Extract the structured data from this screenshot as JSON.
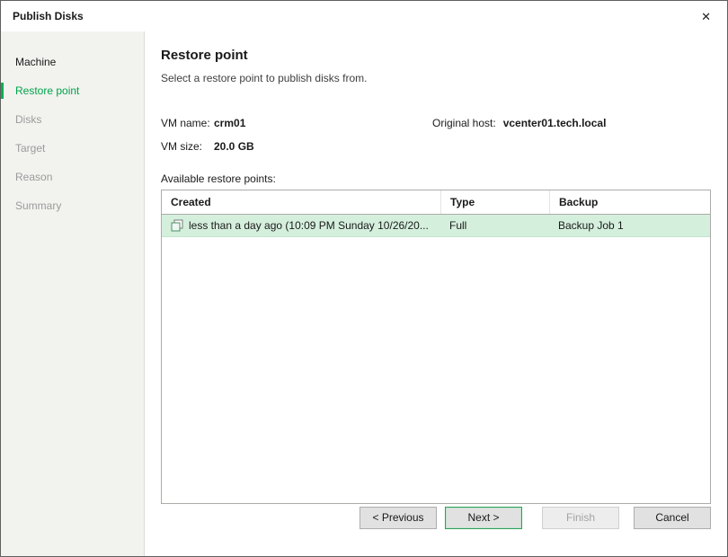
{
  "window": {
    "title": "Publish Disks",
    "close_glyph": "✕"
  },
  "sidebar": {
    "items": [
      {
        "label": "Machine",
        "state": "done"
      },
      {
        "label": "Restore point",
        "state": "active"
      },
      {
        "label": "Disks",
        "state": "pending"
      },
      {
        "label": "Target",
        "state": "pending"
      },
      {
        "label": "Reason",
        "state": "pending"
      },
      {
        "label": "Summary",
        "state": "pending"
      }
    ]
  },
  "main": {
    "title": "Restore point",
    "subtitle": "Select a restore point to publish disks from.",
    "vm_name_label": "VM name:",
    "vm_name": "crm01",
    "original_host_label": "Original host:",
    "original_host": "vcenter01.tech.local",
    "vm_size_label": "VM size:",
    "vm_size": "20.0 GB",
    "table_label": "Available restore points:",
    "table": {
      "columns": [
        "Created",
        "Type",
        "Backup"
      ],
      "rows": [
        {
          "created": "less than a day ago (10:09 PM Sunday 10/26/20...",
          "type": "Full",
          "backup": "Backup Job 1"
        }
      ]
    }
  },
  "footer": {
    "previous_label": "< Previous",
    "next_label": "Next >",
    "finish_label": "Finish",
    "cancel_label": "Cancel"
  },
  "colors": {
    "accent_green": "#00b050",
    "active_step_text": "#00a44a",
    "row_highlight": "#d5efdd",
    "sidebar_bg": "#f2f2ef"
  }
}
